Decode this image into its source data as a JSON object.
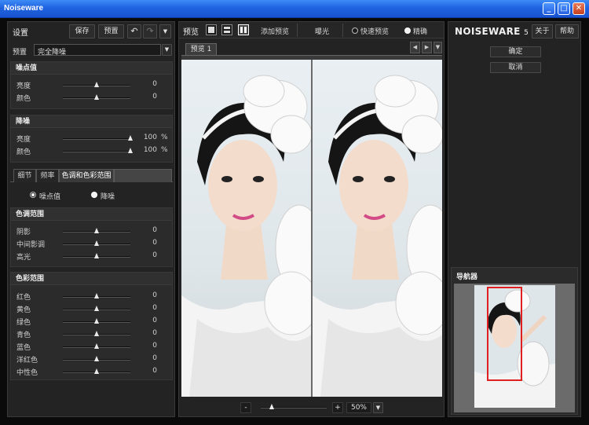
{
  "window": {
    "title": "Noiseware",
    "minimize": "_",
    "maximize": "□",
    "close": "✕"
  },
  "left": {
    "settings_label": "设置",
    "save_label": "保存",
    "preset_button_label": "预置",
    "undo_icon": "↶",
    "redo_icon": "↷",
    "menu_icon": "▼",
    "preset_label": "预置",
    "preset_value": "完全降噪",
    "noise_level": {
      "title": "噪点值",
      "rows": [
        {
          "label": "亮度",
          "value": "0"
        },
        {
          "label": "颜色",
          "value": "0"
        }
      ]
    },
    "noise_reduction": {
      "title": "降噪",
      "rows": [
        {
          "label": "亮度",
          "value": "100",
          "unit": "%"
        },
        {
          "label": "颜色",
          "value": "100",
          "unit": "%"
        }
      ]
    },
    "tabs": [
      "细节",
      "频率",
      "色调和色彩范围"
    ],
    "mode_radios": [
      "噪点值",
      "降噪"
    ],
    "tone_range": {
      "title": "色调范围",
      "rows": [
        {
          "label": "阴影",
          "value": "0"
        },
        {
          "label": "中间影调",
          "value": "0"
        },
        {
          "label": "高光",
          "value": "0"
        }
      ]
    },
    "color_range": {
      "title": "色彩范围",
      "rows": [
        {
          "label": "红色",
          "value": "0"
        },
        {
          "label": "黄色",
          "value": "0"
        },
        {
          "label": "绿色",
          "value": "0"
        },
        {
          "label": "青色",
          "value": "0"
        },
        {
          "label": "蓝色",
          "value": "0"
        },
        {
          "label": "洋红色",
          "value": "0"
        },
        {
          "label": "中性色",
          "value": "0"
        }
      ]
    }
  },
  "center": {
    "preview_label": "预览",
    "add_preview_label": "添加预览",
    "exposure_label": "曝光",
    "quick_preview_label": "快速预览",
    "precise_label": "精确",
    "preview_tab": "预览 1",
    "nav_left": "◀",
    "nav_right": "▶",
    "nav_menu": "▼",
    "zoom_minus": "-",
    "zoom_plus": "+",
    "zoom_value": "50%",
    "zoom_level": 0.5
  },
  "right": {
    "logo_main": "NOISEWARE",
    "logo_version": "5",
    "about_label": "关于",
    "help_label": "帮助",
    "ok_label": "确定",
    "cancel_label": "取消",
    "navigator_label": "导航器"
  },
  "colors": {
    "title_bar": "#1f63e0",
    "panel_bg": "#232323",
    "accent_red": "#e02020"
  }
}
